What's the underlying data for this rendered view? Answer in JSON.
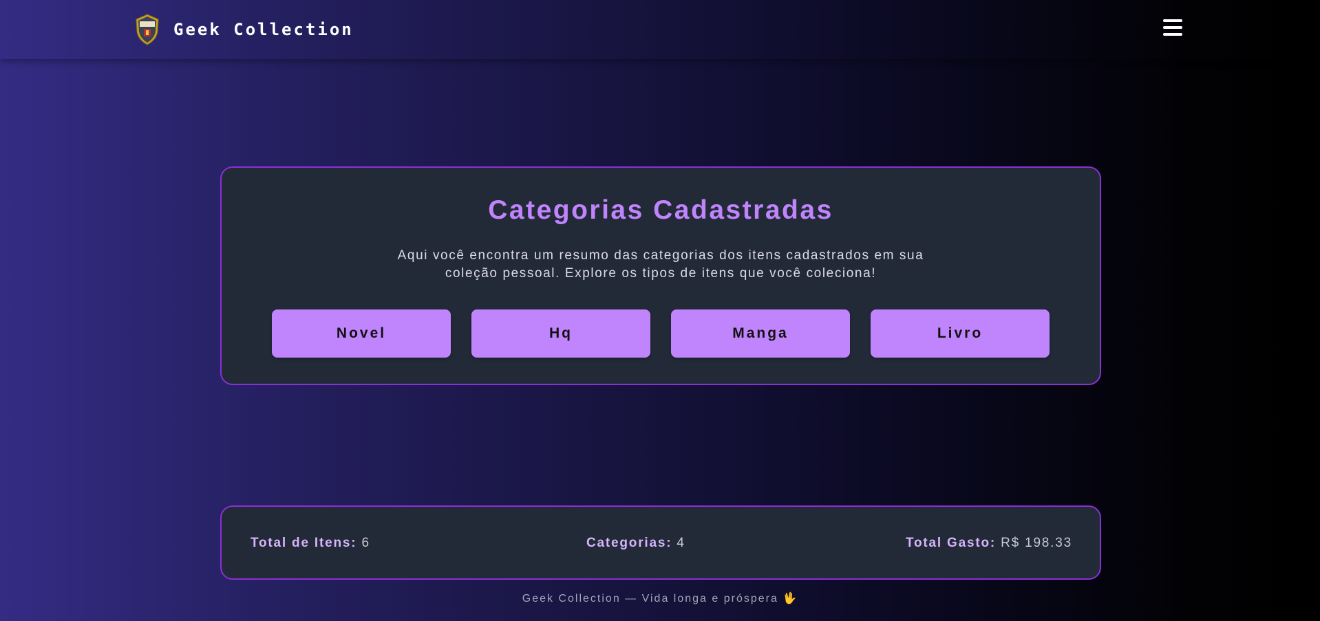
{
  "navbar": {
    "brand_title": "Geek Collection",
    "logo_text": "GEEK COLLECTION",
    "menu_icon": "hamburger-icon"
  },
  "categories_card": {
    "title": "Categorias Cadastradas",
    "description": "Aqui você encontra um resumo das categorias dos itens cadastrados em sua coleção pessoal. Explore os tipos de itens que você coleciona!",
    "buttons": [
      "Novel",
      "Hq",
      "Manga",
      "Livro"
    ]
  },
  "stats": {
    "total_items_label": "Total de Itens:",
    "total_items_value": "6",
    "categories_label": "Categorias:",
    "categories_value": "4",
    "total_spent_label": "Total Gasto:",
    "total_spent_value": "R$ 198.33"
  },
  "footer": {
    "text": "Geek Collection — Vida longa e próspera 🖖"
  },
  "colors": {
    "accent": "#c084fc",
    "card_bg": "#222a38",
    "card_border": "#8b2fd6"
  }
}
